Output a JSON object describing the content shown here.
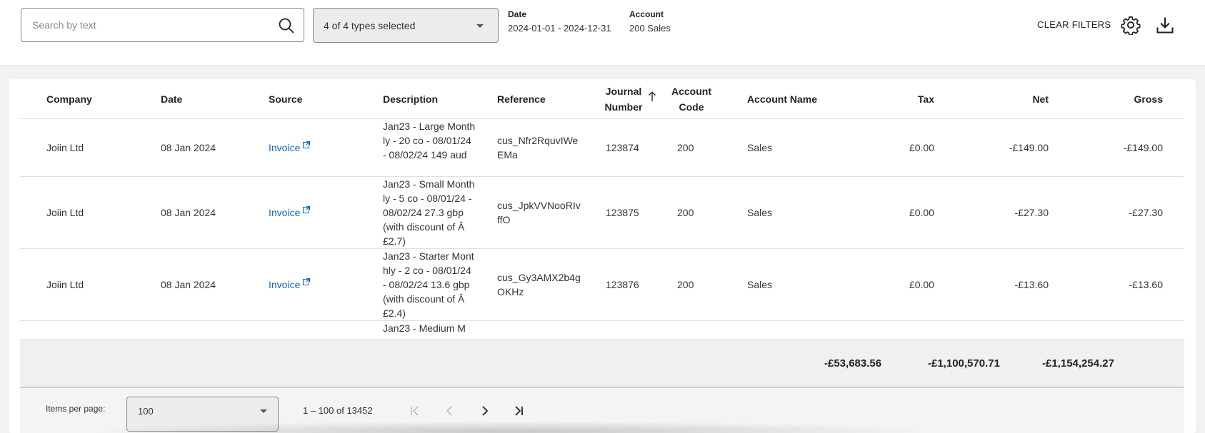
{
  "filters": {
    "search_placeholder": "Search by text",
    "types_selected": "4 of 4 types selected",
    "date_label": "Date",
    "date_value": "2024-01-01 - 2024-12-31",
    "account_label": "Account",
    "account_value": "200 Sales",
    "clear_label": "CLEAR FILTERS"
  },
  "table": {
    "headers": {
      "company": "Company",
      "date": "Date",
      "source": "Source",
      "description": "Description",
      "reference": "Reference",
      "journal_line1": "Journal",
      "journal_line2": "Number",
      "account_code_line1": "Account",
      "account_code_line2": "Code",
      "account_name": "Account Name",
      "tax": "Tax",
      "net": "Net",
      "gross": "Gross"
    },
    "rows": [
      {
        "company": "Joiin Ltd",
        "date": "08 Jan 2024",
        "source": "Invoice",
        "description": "Jan23 - Large Monthly - 20 co - 08/01/24 - 08/02/24 149 aud",
        "reference": "cus_Nfr2RquvIWeEMa",
        "journal": "123874",
        "account_code": "200",
        "account_name": "Sales",
        "tax": "£0.00",
        "net": "-£149.00",
        "gross": "-£149.00"
      },
      {
        "company": "Joiin Ltd",
        "date": "08 Jan 2024",
        "source": "Invoice",
        "description": "Jan23 - Small Monthly - 5 co - 08/01/24 - 08/02/24 27.3 gbp (with discount of Â£2.7)",
        "reference": "cus_JpkVVNooRIvffO",
        "journal": "123875",
        "account_code": "200",
        "account_name": "Sales",
        "tax": "£0.00",
        "net": "-£27.30",
        "gross": "-£27.30"
      },
      {
        "company": "Joiin Ltd",
        "date": "08 Jan 2024",
        "source": "Invoice",
        "description": "Jan23 - Starter Monthly - 2 co - 08/01/24 - 08/02/24 13.6 gbp (with discount of Â£2.4)",
        "reference": "cus_Gy3AMX2b4gOKHz",
        "journal": "123876",
        "account_code": "200",
        "account_name": "Sales",
        "tax": "£0.00",
        "net": "-£13.60",
        "gross": "-£13.60"
      },
      {
        "description": "Jan23 - Medium M"
      }
    ],
    "totals": {
      "tax": "-£53,683.56",
      "net": "-£1,100,570.71",
      "gross": "-£1,154,254.27"
    }
  },
  "pagination": {
    "items_per_page_label": "Items per page:",
    "items_per_page_value": "100",
    "range_text": "1 – 100 of 13452"
  },
  "icons": {
    "search": "search-icon",
    "dropdown": "chevron-down-icon",
    "settings": "gear-icon",
    "download": "download-icon",
    "sort": "arrow-up-icon",
    "external_link": "external-link-icon",
    "first_page": "first-page-icon",
    "prev_page": "chevron-left-icon",
    "next_page": "chevron-right-icon",
    "last_page": "last-page-icon"
  },
  "colors": {
    "link": "#1565c0",
    "totals_bg": "#f0f0f0",
    "page_bg": "#f2f2f2"
  }
}
